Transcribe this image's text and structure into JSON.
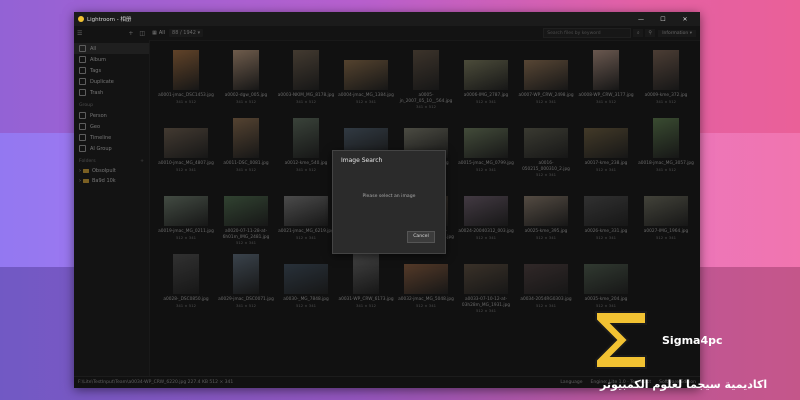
{
  "window": {
    "title": "Lightroom - 相册",
    "minimize": "—",
    "maximize": "☐",
    "close": "✕"
  },
  "toolbar": {
    "tab_all": "All",
    "count": "88 / 1942",
    "search_placeholder": "Search files by keyword",
    "info_label": "Information"
  },
  "sidebar": {
    "items": [
      {
        "label": "All"
      },
      {
        "label": "Album"
      },
      {
        "label": "Tags"
      },
      {
        "label": "Duplicate"
      },
      {
        "label": "Trash"
      }
    ],
    "group_header": "Group",
    "group_items": [
      {
        "label": "Person"
      },
      {
        "label": "Geo"
      },
      {
        "label": "Timeline"
      },
      {
        "label": "AI Group"
      }
    ],
    "folders_header": "Folders",
    "folders_plus": "+",
    "folders": [
      {
        "label": "Obsolpult"
      },
      {
        "label": "Ba9d 10k"
      }
    ]
  },
  "thumbnails": [
    {
      "name": "a0001-jmac_DSC1453.jpg",
      "dim": "341 × 512",
      "color": "#b07a4a"
    },
    {
      "name": "a0002-dgw_005.jpg",
      "dim": "341 × 512",
      "color": "#c9a78a"
    },
    {
      "name": "a0003-NKIM_MG_8178.jpg",
      "dim": "341 × 512",
      "color": "#7a6a58"
    },
    {
      "name": "a0004-jmac_MG_1384.jpg",
      "dim": "512 × 341",
      "color": "#9a7a55"
    },
    {
      "name": "a0005-jn_2007_05_10__564.jpg",
      "dim": "341 × 512",
      "color": "#6e5e4e"
    },
    {
      "name": "a0006-IMG_2787.jpg",
      "dim": "512 × 341",
      "color": "#8a8a6a"
    },
    {
      "name": "a0007-WP_CRW_2498.jpg",
      "dim": "512 × 341",
      "color": "#a08060"
    },
    {
      "name": "a0008-WP_CRW_3177.jpg",
      "dim": "341 × 512",
      "color": "#c0a090"
    },
    {
      "name": "a0009-kme_372.jpg",
      "dim": "341 × 512",
      "color": "#8a7060"
    },
    {
      "name": "a0010-jmac_MG_4807.jpg",
      "dim": "512 × 341",
      "color": "#7a6a5a"
    },
    {
      "name": "a0011-DSC_0081.jpg",
      "dim": "341 × 512",
      "color": "#9a7a5a"
    },
    {
      "name": "a0012-kme_540.jpg",
      "dim": "341 × 512",
      "color": "#6a7a6a"
    },
    {
      "name": "a0013-jmac_DSC0015.jpg",
      "dim": "512 × 341",
      "color": "#5a6a7a"
    },
    {
      "name": "a0014-DSC_0007.jpg",
      "dim": "512 × 341",
      "color": "#8a8a7a"
    },
    {
      "name": "a0015-jmac_MG_0799.jpg",
      "dim": "512 × 341",
      "color": "#7a8a6a"
    },
    {
      "name": "a0016-050215_000310_2.jpg",
      "dim": "512 × 341",
      "color": "#6a6a5a"
    },
    {
      "name": "a0017-kme_238.jpg",
      "dim": "512 × 341",
      "color": "#7a6a4a"
    },
    {
      "name": "a0018-jmac_MG_3057.jpg",
      "dim": "341 × 512",
      "color": "#6a8a5a"
    },
    {
      "name": "a0019-jmac_MG_0211.jpg",
      "dim": "512 × 341",
      "color": "#7a8a7a"
    },
    {
      "name": "a0020-07-11-28-at-6h01m_IMG_2481.jpg",
      "dim": "512 × 341",
      "color": "#5a7a5a"
    },
    {
      "name": "a0021-jmac_MG_6219.jpg",
      "dim": "512 × 341",
      "color": "#8a8a8a"
    },
    {
      "name": "a0022-IMG_2308.jpg",
      "dim": "512 × 341",
      "color": "#7a7a8a"
    },
    {
      "name": "a0023-07-08-22-at-12h48m13s_MG_1982.jpg",
      "dim": "512 × 341",
      "color": "#6a5a4a"
    },
    {
      "name": "a0024-20040312_003.jpg",
      "dim": "512 × 341",
      "color": "#7a6a7a"
    },
    {
      "name": "a0025-kme_395.jpg",
      "dim": "512 × 341",
      "color": "#9a8a7a"
    },
    {
      "name": "a0026-kme_331.jpg",
      "dim": "512 × 341",
      "color": "#5a5a5a"
    },
    {
      "name": "a0027-IMG_1964.jpg",
      "dim": "512 × 341",
      "color": "#7a7a6a"
    },
    {
      "name": "a0028-_DSC0850.jpg",
      "dim": "341 × 512",
      "color": "#5a5a5a"
    },
    {
      "name": "a0029-jmac_DSC0071.jpg",
      "dim": "341 × 512",
      "color": "#6a7a8a"
    },
    {
      "name": "a0030-_MG_7848.jpg",
      "dim": "512 × 341",
      "color": "#4a5a6a"
    },
    {
      "name": "a0031-WP_CRW_6173.jpg",
      "dim": "341 × 512",
      "color": "#7a7a7a"
    },
    {
      "name": "a0032-jmac_MG_5048.jpg",
      "dim": "512 × 341",
      "color": "#9a6a4a"
    },
    {
      "name": "a0033-07-10-12-at-03h28m_MG_1931.jpg",
      "dim": "512 × 341",
      "color": "#6a5a4a"
    },
    {
      "name": "a0034-2054RG0303.jpg",
      "dim": "512 × 341",
      "color": "#5a4a4a"
    },
    {
      "name": "a0035-kme_204.jpg",
      "dim": "512 × 341",
      "color": "#5a6a5a"
    }
  ],
  "statusbar": {
    "path": "F:\\Lite\\TestInput\\Team\\a0034-WP_CRW_6220.jpg  227.4 KB  512 × 341",
    "language": "Language",
    "engine": "Engine: Lite 1.0 · Tesseract",
    "version": "Software Edition"
  },
  "dialog": {
    "title": "Image Search",
    "prompt": "Please select an image",
    "cancel": "Cancel"
  },
  "watermark": {
    "brand": "Sigma4pc",
    "arabic": "اكاديمية سيجما لعلوم الكمبيوتر"
  }
}
